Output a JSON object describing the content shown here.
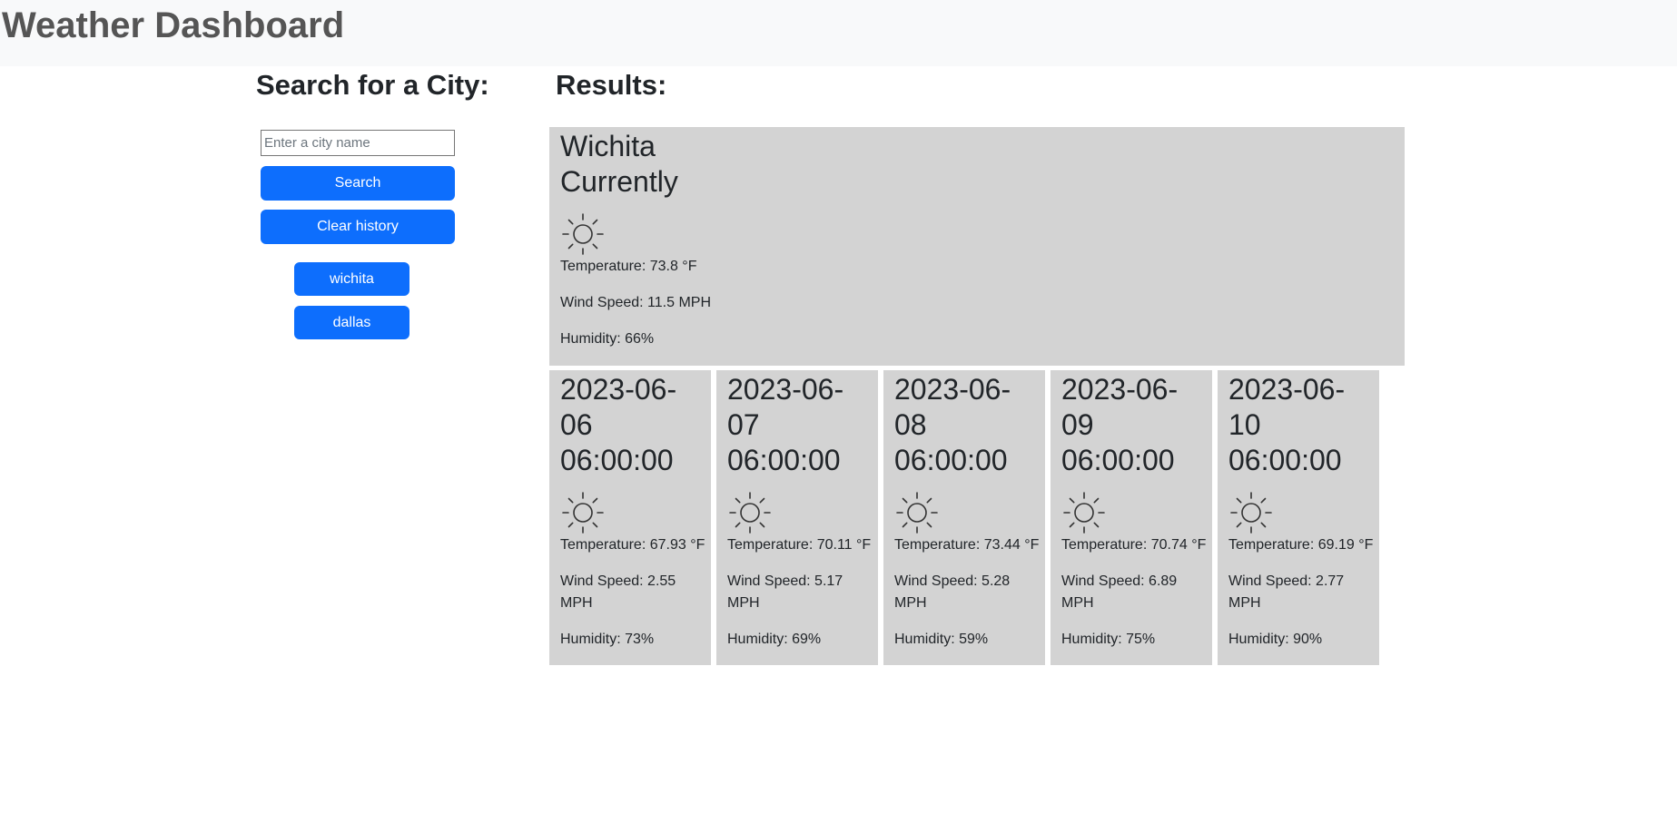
{
  "header": {
    "title": "Weather Dashboard"
  },
  "search": {
    "heading": "Search for a City:",
    "placeholder": "Enter a city name",
    "value": "",
    "search_label": "Search",
    "clear_label": "Clear history",
    "history": [
      "wichita",
      "dallas"
    ]
  },
  "results": {
    "heading": "Results:",
    "current": {
      "city": "Wichita",
      "subtitle": "Currently",
      "icon": "sun-icon",
      "temperature": "Temperature: 73.8 °F",
      "wind": "Wind Speed: 11.5 MPH",
      "humidity": "Humidity: 66%"
    },
    "forecast": [
      {
        "date": "2023-06-06 06:00:00",
        "icon": "sun-icon",
        "temperature": "Temperature: 67.93 °F",
        "wind": "Wind Speed: 2.55 MPH",
        "humidity": "Humidity: 73%"
      },
      {
        "date": "2023-06-07 06:00:00",
        "icon": "sun-icon",
        "temperature": "Temperature: 70.11 °F",
        "wind": "Wind Speed: 5.17 MPH",
        "humidity": "Humidity: 69%"
      },
      {
        "date": "2023-06-08 06:00:00",
        "icon": "sun-icon",
        "temperature": "Temperature: 73.44 °F",
        "wind": "Wind Speed: 5.28 MPH",
        "humidity": "Humidity: 59%"
      },
      {
        "date": "2023-06-09 06:00:00",
        "icon": "sun-icon",
        "temperature": "Temperature: 70.74 °F",
        "wind": "Wind Speed: 6.89 MPH",
        "humidity": "Humidity: 75%"
      },
      {
        "date": "2023-06-10 06:00:00",
        "icon": "sun-icon",
        "temperature": "Temperature: 69.19 °F",
        "wind": "Wind Speed: 2.77 MPH",
        "humidity": "Humidity: 90%"
      }
    ]
  },
  "colors": {
    "button": "#0d6efd",
    "card_background": "#d3d3d3",
    "header_background": "#f8f9fa",
    "title_text": "#555555"
  }
}
